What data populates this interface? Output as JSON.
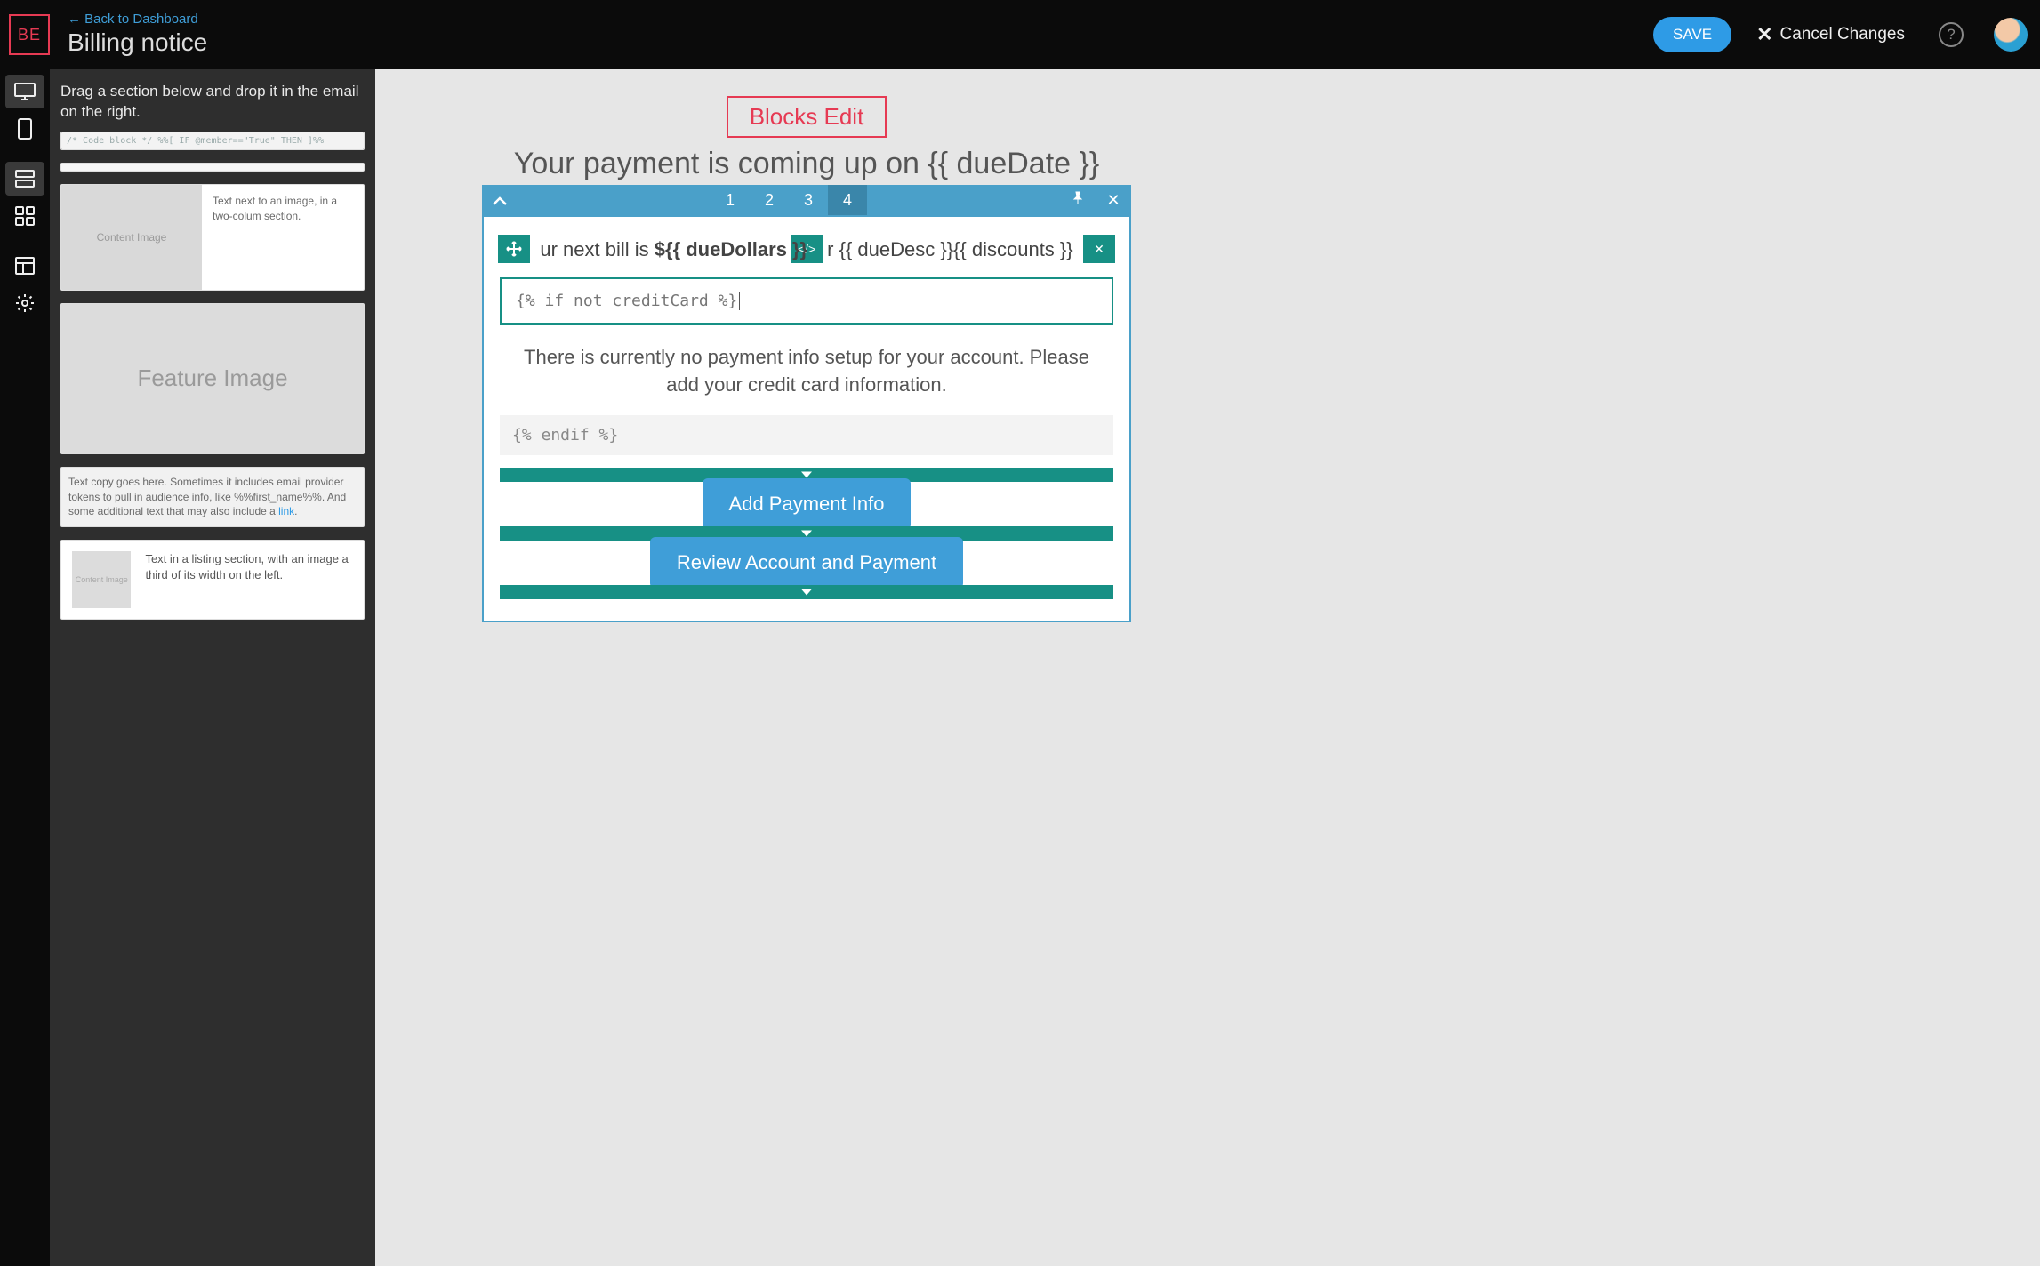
{
  "header": {
    "logoText": "BE",
    "backLink": "← Back to Dashboard",
    "title": "Billing notice",
    "save": "SAVE",
    "cancel": "Cancel Changes"
  },
  "sidebar": {
    "hint": "Drag a section below and drop it in the email on the right.",
    "blocks": {
      "codeSnippet": "/* Code block */ %%[ IF @member==\"True\" THEN ]%%",
      "twoColImageLabel": "Content Image",
      "twoColText": "Text next to an image, in a two-colum section.",
      "featureLabel": "Feature Image",
      "textBlock": "Text copy goes here. Sometimes it includes email provider tokens to pull in audience info, like %%first_name%%. And some additional text that may also include a ",
      "textBlockLink": "link",
      "listingImageLabel": "Content Image",
      "listingText": "Text in a listing section, with an image a third of its width on the left."
    }
  },
  "canvas": {
    "brand": "Blocks Edit",
    "headline": "Your payment is coming up on {{ dueDate }}",
    "tabs": [
      "1",
      "2",
      "3",
      "4"
    ],
    "activeTab": 3,
    "billLine": {
      "prefix": "ur next bill is ",
      "amount": "${{ dueDollars }}",
      "mid": "r {{ dueDesc }}{{ discounts }}"
    },
    "codeIf": "{% if not creditCard %}",
    "paragraph": "There is currently no payment info setup for your account. Please add your credit card information.",
    "codeEndif": "{% endif %}",
    "buttons": {
      "addPayment": "Add Payment Info",
      "review": "Review Account and Payment"
    }
  },
  "icons": {
    "desktop": "desktop",
    "mobile": "mobile",
    "rows": "rows",
    "grid": "grid",
    "layout": "layout",
    "settings": "settings",
    "chevronUp": "▲",
    "pin": "📌",
    "close": "✕",
    "move": "✥",
    "code": "</>",
    "x": "✕",
    "help": "?"
  }
}
